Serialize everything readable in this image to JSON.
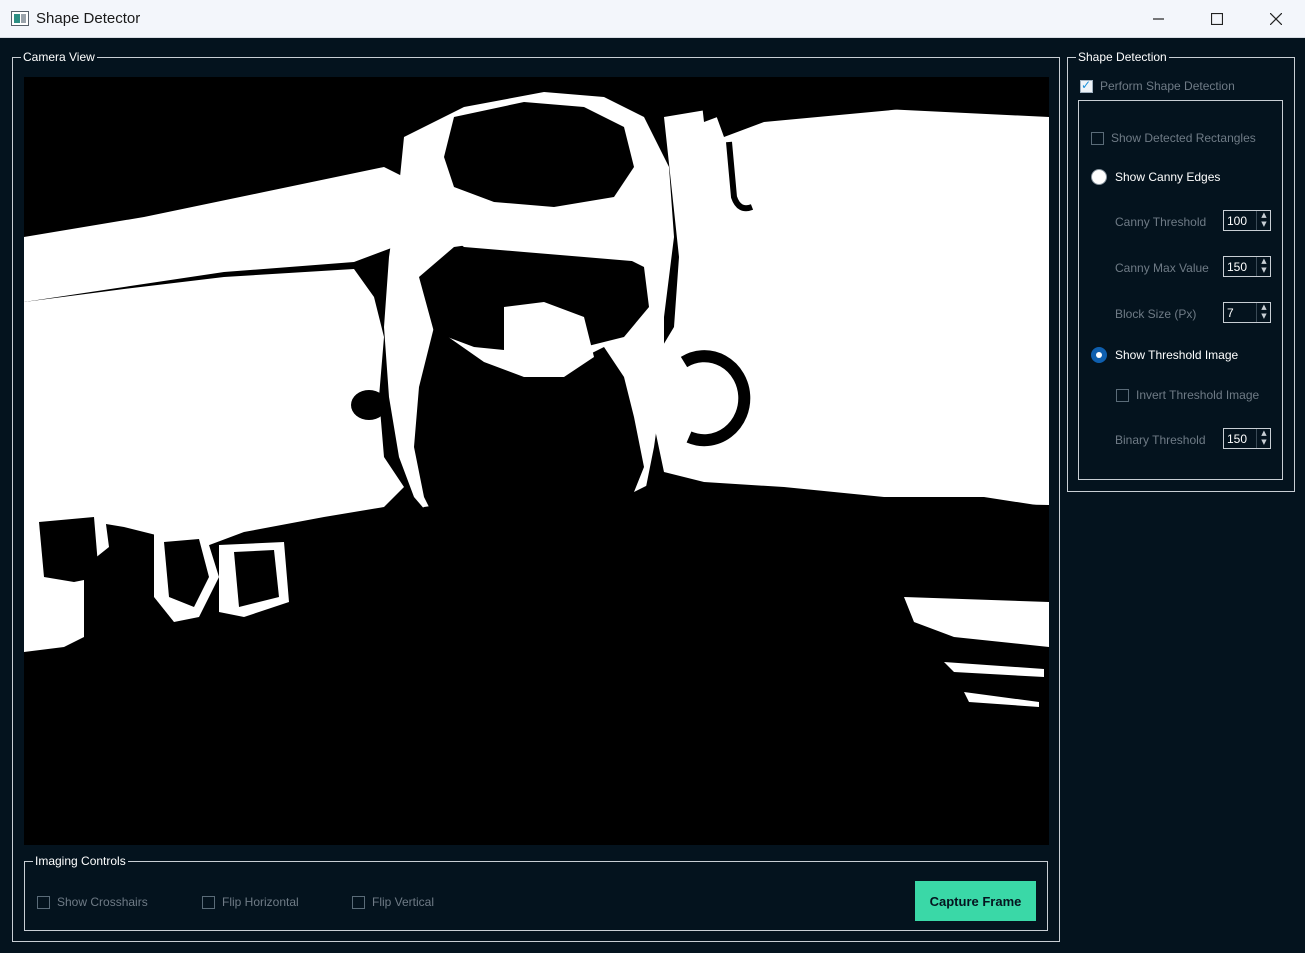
{
  "window": {
    "title": "Shape Detector"
  },
  "camera": {
    "group_title": "Camera View"
  },
  "imaging_controls": {
    "group_title": "Imaging Controls",
    "show_crosshairs": {
      "label": "Show Crosshairs",
      "checked": false
    },
    "flip_horizontal": {
      "label": "Flip Horizontal",
      "checked": false
    },
    "flip_vertical": {
      "label": "Flip Vertical",
      "checked": false
    },
    "capture_label": "Capture Frame",
    "capture_color": "#3ad8a7"
  },
  "shape_detection": {
    "group_title": "Shape Detection",
    "perform": {
      "label": "Perform Shape Detection",
      "checked": true
    },
    "show_rectangles": {
      "label": "Show Detected Rectangles",
      "checked": false
    },
    "show_canny": {
      "label": "Show Canny Edges",
      "selected": false
    },
    "canny_threshold": {
      "label": "Canny Threshold",
      "value": "100"
    },
    "canny_max": {
      "label": "Canny Max Value",
      "value": "150"
    },
    "block_size": {
      "label": "Block Size (Px)",
      "value": "7"
    },
    "show_threshold": {
      "label": "Show Threshold Image",
      "selected": true
    },
    "invert_threshold": {
      "label": "Invert Threshold Image",
      "checked": false
    },
    "binary_threshold": {
      "label": "Binary Threshold",
      "value": "150"
    }
  },
  "colors": {
    "background": "#04131e",
    "accent": "#0f5fae",
    "button": "#3ad8a7"
  }
}
